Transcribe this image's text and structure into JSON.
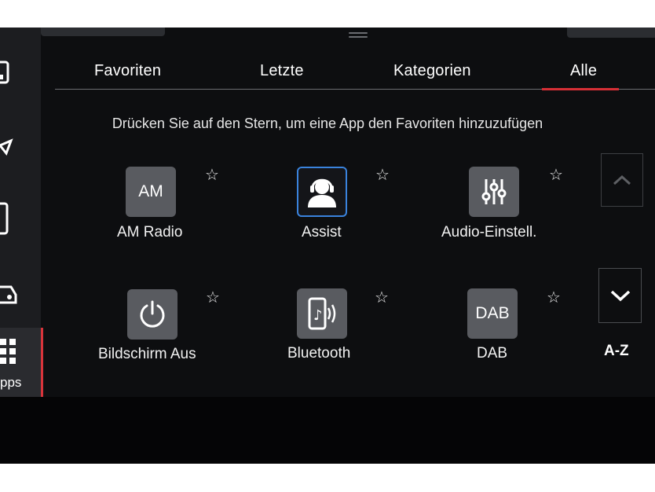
{
  "tabs": [
    {
      "label": "Favoriten",
      "active": false
    },
    {
      "label": "Letzte",
      "active": false
    },
    {
      "label": "Kategorien",
      "active": false
    },
    {
      "label": "Alle",
      "active": true
    }
  ],
  "hint": "Drücken Sie auf den Stern, um eine App den Favoriten hinzuzufügen",
  "sidebar": {
    "apps_label": "pps",
    "icons": [
      "media-icon",
      "navigation-icon",
      "phone-icon",
      "car-icon",
      "apps-grid-icon"
    ]
  },
  "apps": [
    {
      "label": "AM Radio",
      "icon_text": "AM",
      "icon": "am-radio-icon",
      "favorite": false
    },
    {
      "label": "Assist",
      "icon_text": "",
      "icon": "headset-assist-icon",
      "favorite": false
    },
    {
      "label": "Audio-Einstell.",
      "icon_text": "",
      "icon": "equalizer-sliders-icon",
      "favorite": false
    },
    {
      "label": "Bildschirm Aus",
      "icon_text": "",
      "icon": "power-icon",
      "favorite": false
    },
    {
      "label": "Bluetooth",
      "icon_text": "",
      "icon": "phone-audio-icon",
      "favorite": false
    },
    {
      "label": "DAB",
      "icon_text": "DAB",
      "icon": "dab-icon",
      "favorite": false
    }
  ],
  "scroll": {
    "az_label": "A-Z"
  },
  "colors": {
    "accent": "#d62f36",
    "assist_border": "#3a83dd",
    "icon_tile": "#595b60",
    "background": "#0d0e10"
  }
}
